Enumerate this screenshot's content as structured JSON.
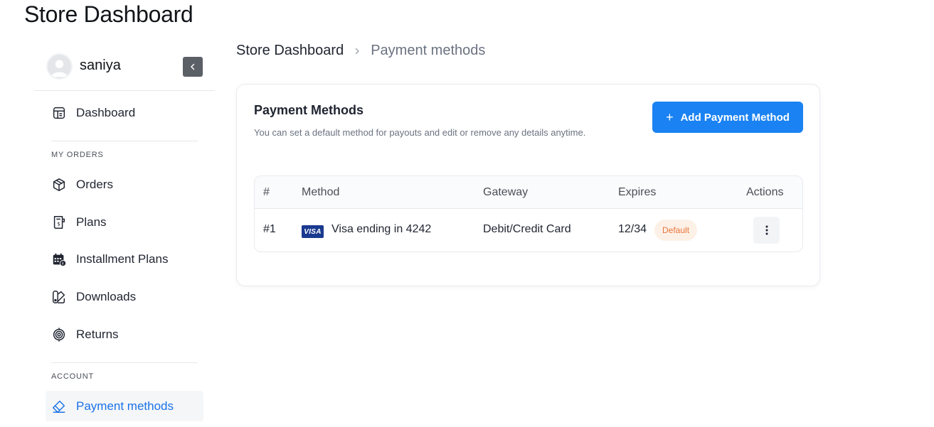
{
  "page": {
    "title": "Store Dashboard"
  },
  "sidebar": {
    "user": {
      "name": "saniya"
    },
    "items": [
      {
        "label": "Dashboard",
        "icon": "dashboard-icon"
      },
      {
        "label": "Orders",
        "icon": "box-icon"
      },
      {
        "label": "Plans",
        "icon": "plans-icon"
      },
      {
        "label": "Installment Plans",
        "icon": "calendar-icon"
      },
      {
        "label": "Downloads",
        "icon": "downloads-icon"
      },
      {
        "label": "Returns",
        "icon": "returns-icon"
      },
      {
        "label": "Payment methods",
        "icon": "payment-icon",
        "active": true
      }
    ],
    "sections": {
      "orders": "MY ORDERS",
      "account": "ACCOUNT"
    }
  },
  "breadcrumb": {
    "root": "Store Dashboard",
    "current": "Payment methods"
  },
  "card": {
    "title": "Payment Methods",
    "subtitle": "You can set a default method for payouts and edit or remove any details anytime.",
    "add_button": {
      "icon": "+",
      "label": "Add Payment Method"
    }
  },
  "table": {
    "headers": [
      "#",
      "Method",
      "Gateway",
      "Expires",
      "Actions"
    ],
    "rows": [
      {
        "index": "#1",
        "brand": "VISA",
        "method": "Visa ending in 4242",
        "gateway": "Debit/Credit Card",
        "expires": "12/34",
        "badge": "Default"
      }
    ]
  },
  "colors": {
    "accent": "#1a82f2",
    "active_text": "#1a73e8",
    "badge_bg": "#fdf1e7",
    "badge_text": "#e8743b",
    "visa_blue": "#1a3a8f"
  }
}
